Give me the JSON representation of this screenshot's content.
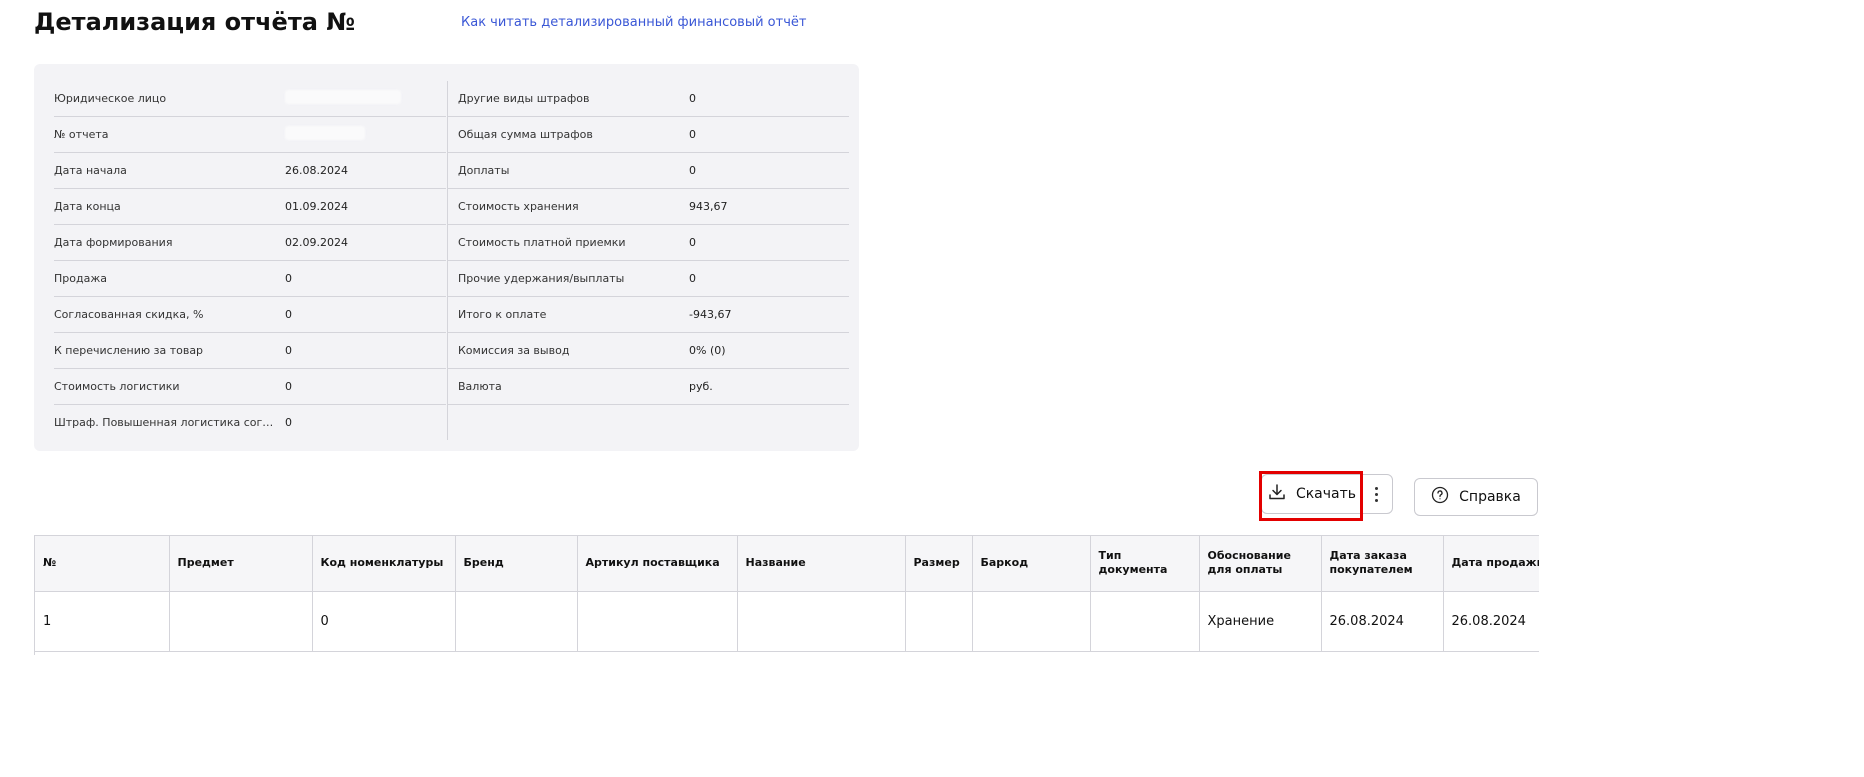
{
  "header": {
    "title": "Детализация отчёта №",
    "help_link": "Как читать детализированный финансовый отчёт"
  },
  "summary": {
    "left": [
      {
        "label": "Юридическое лицо",
        "value": ""
      },
      {
        "label": "№ отчета",
        "value": ""
      },
      {
        "label": "Дата начала",
        "value": "26.08.2024"
      },
      {
        "label": "Дата конца",
        "value": "01.09.2024"
      },
      {
        "label": "Дата формирования",
        "value": "02.09.2024"
      },
      {
        "label": "Продажа",
        "value": "0"
      },
      {
        "label": "Согласованная скидка, %",
        "value": "0"
      },
      {
        "label": "К перечислению за товар",
        "value": "0"
      },
      {
        "label": "Стоимость логистики",
        "value": "0"
      },
      {
        "label": "Штраф. Повышенная логистика соглас…",
        "value": "0"
      }
    ],
    "right": [
      {
        "label": "Другие виды штрафов",
        "value": "0"
      },
      {
        "label": "Общая сумма штрафов",
        "value": "0"
      },
      {
        "label": "Доплаты",
        "value": "0"
      },
      {
        "label": "Стоимость хранения",
        "value": "943,67"
      },
      {
        "label": "Стоимость платной приемки",
        "value": "0"
      },
      {
        "label": "Прочие удержания/выплаты",
        "value": "0"
      },
      {
        "label": "Итого к оплате",
        "value": "-943,67"
      },
      {
        "label": "Комиссия за вывод",
        "value": "0% (0)"
      },
      {
        "label": "Валюта",
        "value": "руб."
      }
    ]
  },
  "toolbar": {
    "download_label": "Скачать",
    "help_label": "Справка"
  },
  "table": {
    "columns": [
      "№",
      "Предмет",
      "Код номенклатуры",
      "Бренд",
      "Артикул поставщика",
      "Название",
      "Размер",
      "Баркод",
      "Тип документа",
      "Обоснование для оплаты",
      "Дата заказа покупателем",
      "Дата продажи"
    ],
    "rows": [
      [
        "1",
        "",
        "0",
        "",
        "",
        "",
        "",
        "",
        "",
        "Хранение",
        "26.08.2024",
        "26.08.2024"
      ]
    ]
  },
  "colors": {
    "link": "#3a57d6",
    "panel_bg": "#f3f3f6",
    "highlight": "#e30000"
  }
}
